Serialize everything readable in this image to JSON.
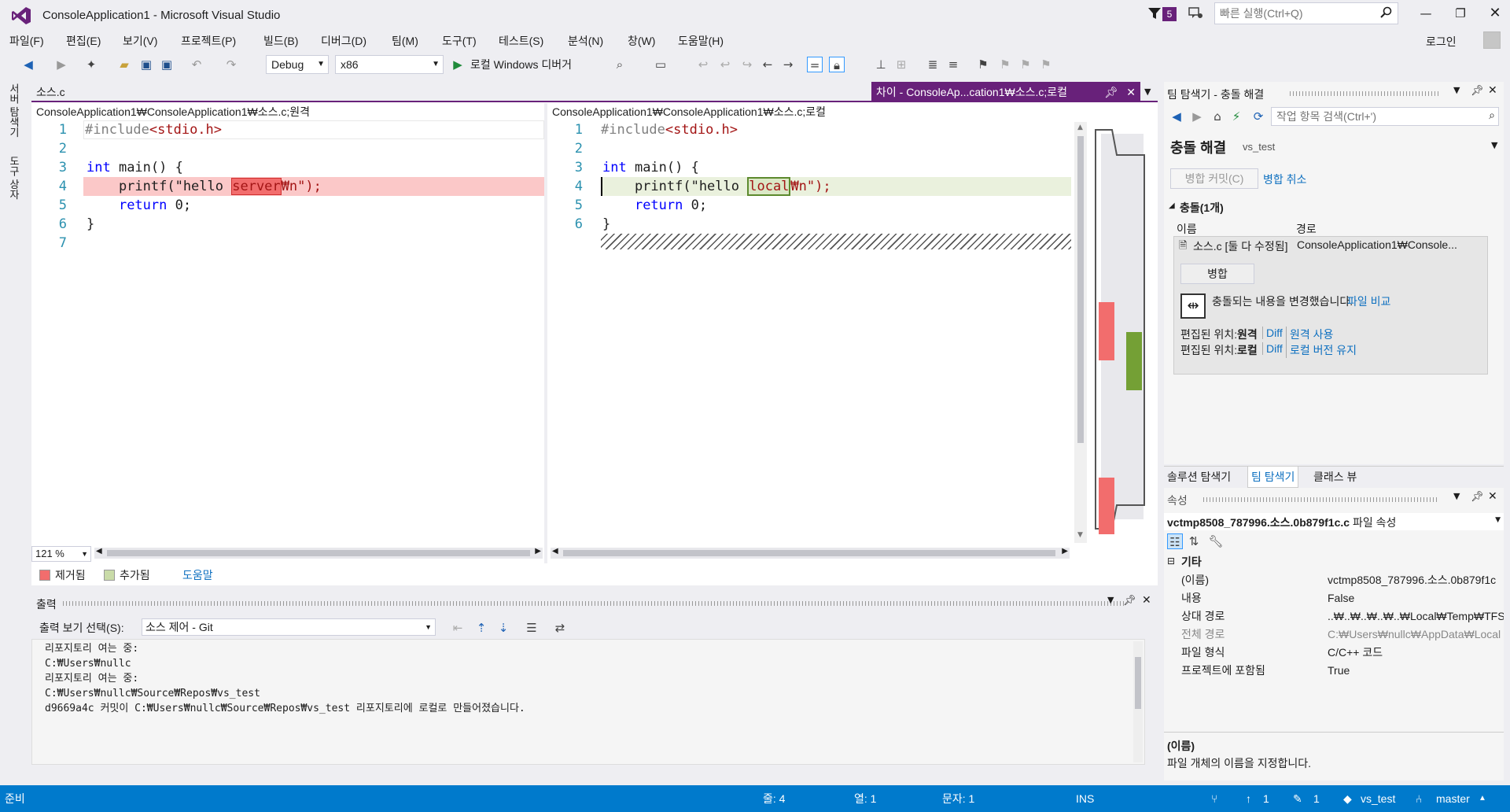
{
  "window": {
    "title": "ConsoleApplication1 - Microsoft Visual Studio",
    "notification_count": "5",
    "quick_launch_placeholder": "빠른 실행(Ctrl+Q)",
    "login": "로그인"
  },
  "menu": [
    "파일(F)",
    "편집(E)",
    "보기(V)",
    "프로젝트(P)",
    "빌드(B)",
    "디버그(D)",
    "팀(M)",
    "도구(T)",
    "테스트(S)",
    "분석(N)",
    "창(W)",
    "도움말(H)"
  ],
  "toolbar": {
    "configuration": "Debug",
    "platform": "x86",
    "run_label": "로컬 Windows 디버거"
  },
  "side_tabs": [
    "서버 탐색기",
    "도구 상자"
  ],
  "editor": {
    "file_tab": "소스.c",
    "diff_tab": "차이 - ConsoleAp...cation1₩소스.c;로컬",
    "left_header": "ConsoleApplication1₩ConsoleApplication1₩소스.c;원격",
    "right_header": "ConsoleApplication1₩ConsoleApplication1₩소스.c;로컬",
    "left_lines": [
      {
        "n": "1",
        "pp": "#include",
        "inc": "<stdio.h>"
      },
      {
        "n": "2"
      },
      {
        "n": "3",
        "kw": "int",
        "rest": " main() {"
      },
      {
        "n": "4",
        "pre": "    printf(\"hello ",
        "hl": "server",
        "post": "₩n\");"
      },
      {
        "n": "5",
        "pre": "    ",
        "kw": "return",
        "rest": " 0;"
      },
      {
        "n": "6",
        "rest": "}"
      },
      {
        "n": "7"
      }
    ],
    "right_lines": [
      {
        "n": "1",
        "pp": "#include",
        "inc": "<stdio.h>"
      },
      {
        "n": "2"
      },
      {
        "n": "3",
        "kw": "int",
        "rest": " main() {"
      },
      {
        "n": "4",
        "pre": "    printf(\"hello ",
        "hl": "local",
        "post": "₩n\");"
      },
      {
        "n": "5",
        "pre": "    ",
        "kw": "return",
        "rest": " 0;"
      },
      {
        "n": "6",
        "rest": "}"
      }
    ],
    "zoom": "121 %",
    "legend_removed": "제거됨",
    "legend_added": "추가됨",
    "legend_help": "도움말"
  },
  "output": {
    "title": "출력",
    "source_label": "출력 보기 선택(S):",
    "source_value": "소스 제어 - Git",
    "lines": [
      "리포지토리 여는 중:",
      "C:₩Users₩nullc",
      "리포지토리 여는 중:",
      "C:₩Users₩nullc₩Source₩Repos₩vs_test",
      "d9669a4c 커밋이 C:₩Users₩nullc₩Source₩Repos₩vs_test 리포지토리에 로컬로 만들어졌습니다."
    ]
  },
  "team_explorer": {
    "title": "팀 탐색기 - 충돌 해결",
    "search_placeholder": "작업 항목 검색(Ctrl+')",
    "page_title": "충돌 해결",
    "repo": "vs_test",
    "merge_commit": "병합 커밋(C)",
    "abort_merge": "병합 취소",
    "conflicts_header": "충돌(1개)",
    "col_name": "이름",
    "col_path": "경로",
    "conflict_name": "소스.c [둘 다 수정됨]",
    "conflict_path": "ConsoleApplication1₩Console...",
    "merge_button": "병합",
    "conflict_msg": "충돌되는 내용을 변경했습니다.",
    "compare_files": "파일 비교",
    "edited_at_label": "편집된 위치:",
    "remote": "원격",
    "local": "로컬",
    "diff": "Diff",
    "take_remote": "원격 사용",
    "keep_local": "로컬 버전 유지",
    "bottom_tabs": [
      "솔루션 탐색기",
      "팀 탐색기",
      "클래스 뷰"
    ]
  },
  "properties": {
    "title": "속성",
    "object": "vctmp8508_787996.소스.0b879f1c.c",
    "object_suffix": "파일 속성",
    "category": "기타",
    "rows": [
      {
        "k": "(이름)",
        "v": "vctmp8508_787996.소스.0b879f1c"
      },
      {
        "k": "내용",
        "v": "False"
      },
      {
        "k": "상대 경로",
        "v": "..₩..₩..₩..₩..₩Local₩Temp₩TFSTe"
      },
      {
        "k": "전체 경로",
        "v": "C:₩Users₩nullc₩AppData₩Local"
      },
      {
        "k": "파일 형식",
        "v": "C/C++ 코드"
      },
      {
        "k": "프로젝트에 포함됨",
        "v": "True"
      }
    ],
    "desc_title": "(이름)",
    "desc_text": "파일 개체의 이름을 지정합니다."
  },
  "status": {
    "ready": "준비",
    "line": "줄: 4",
    "col": "열: 1",
    "ch": "문자: 1",
    "ins": "INS",
    "up": "1",
    "pending": "1",
    "repo": "vs_test",
    "branch": "master"
  },
  "colors": {
    "accent": "#68217a",
    "status": "#007acc",
    "removed": "#f26d6d",
    "added": "#74a035"
  }
}
